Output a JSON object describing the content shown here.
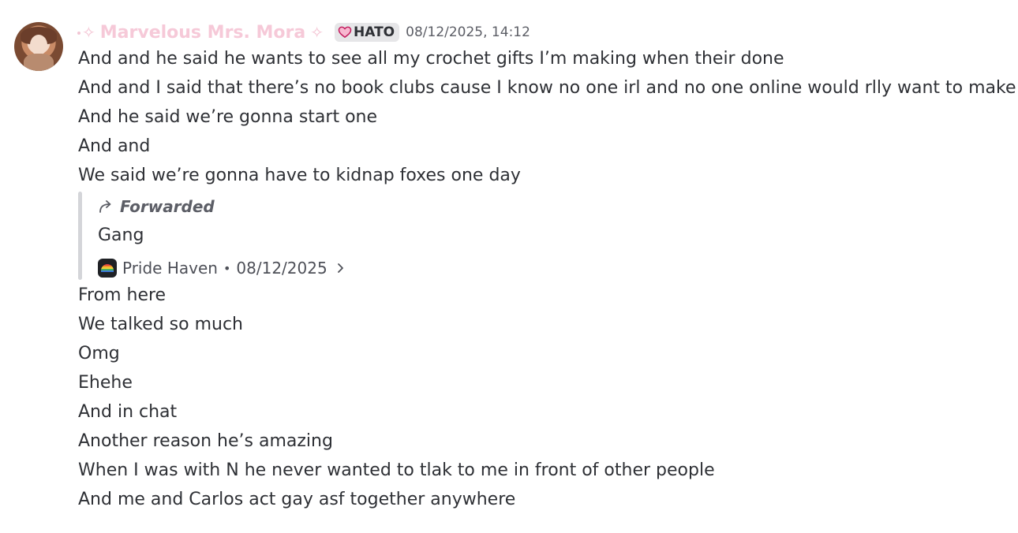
{
  "message": {
    "author": {
      "name": "Marvelous Mrs. Mora",
      "name_color": "#f6c9d8",
      "decoration_left": "✧",
      "decoration_right": "✧",
      "tag": "HATO",
      "tag_icon": "pink-heart-icon"
    },
    "timestamp": "08/12/2025, 14:12",
    "lines_before": [
      "And and he said he wants to see all my crochet gifts I’m making when their done",
      "And and I said that there’s no book clubs cause I know no one irl and no one online would rlly want to make one",
      "And he said we’re gonna start one",
      "And and",
      "We said we’re gonna have to kidnap foxes one day"
    ],
    "forwarded": {
      "label": "Forwarded",
      "text": "Gang",
      "source_server": "Pride Haven",
      "source_date": "08/12/2025",
      "separator": "•",
      "server_icon": "rainbow-icon"
    },
    "lines_after": [
      "From here",
      "We talked so much",
      "Omg",
      "Ehehe",
      "And in chat",
      "Another reason he’s amazing",
      "When I was with N he never wanted to tlak to me in front of other people",
      "And me and Carlos act gay asf together anywhere"
    ]
  }
}
